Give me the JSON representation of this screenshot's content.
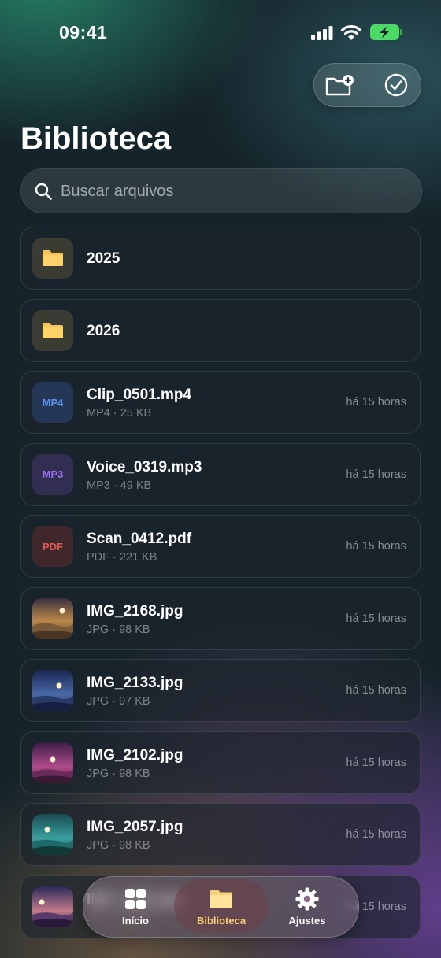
{
  "status": {
    "time": "09:41"
  },
  "page": {
    "title": "Biblioteca"
  },
  "search": {
    "placeholder": "Buscar arquivos"
  },
  "files": [
    {
      "name": "2025",
      "kind": "folder"
    },
    {
      "name": "2026",
      "kind": "folder"
    },
    {
      "name": "Clip_0501.mp4",
      "kind": "mp4",
      "badge": "MP4",
      "meta": "MP4 · 25 KB",
      "time": "há 15 horas"
    },
    {
      "name": "Voice_0319.mp3",
      "kind": "mp3",
      "badge": "MP3",
      "meta": "MP3 · 49 KB",
      "time": "há 15 horas"
    },
    {
      "name": "Scan_0412.pdf",
      "kind": "pdf",
      "badge": "PDF",
      "meta": "PDF · 221 KB",
      "time": "há 15 horas"
    },
    {
      "name": "IMG_2168.jpg",
      "kind": "image",
      "meta": "JPG · 98 KB",
      "time": "há 15 horas"
    },
    {
      "name": "IMG_2133.jpg",
      "kind": "image",
      "meta": "JPG · 97 KB",
      "time": "há 15 horas"
    },
    {
      "name": "IMG_2102.jpg",
      "kind": "image",
      "meta": "JPG · 98 KB",
      "time": "há 15 horas"
    },
    {
      "name": "IMG_2057.jpg",
      "kind": "image",
      "meta": "JPG · 98 KB",
      "time": "há 15 horas"
    },
    {
      "name": "IMG_2011.jpg",
      "kind": "image",
      "meta": "JPG · 98 KB",
      "time": "há 15 horas"
    }
  ],
  "tabs": [
    {
      "label": "Início",
      "icon": "grid-icon"
    },
    {
      "label": "Biblioteca",
      "icon": "folder-icon",
      "active": true
    },
    {
      "label": "Ajustes",
      "icon": "gear-icon"
    }
  ],
  "colors": {
    "accent": "#f7d27b",
    "battery": "#4cd964"
  }
}
